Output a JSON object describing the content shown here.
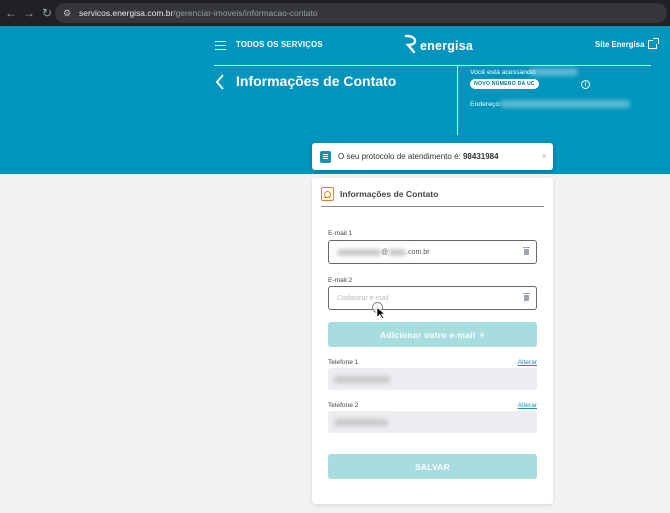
{
  "browser": {
    "url_host": "servicos.energisa.com.br",
    "url_path": "/gerenciar-imoveis/informacao-contato"
  },
  "header": {
    "services_label": "TODOS OS SERVIÇOS",
    "logo_text": "energisa",
    "site_link": "Site Energisa",
    "page_title": "Informações de Contato",
    "accessing_label": "Você está acessando:",
    "uc_badge": "NOVO NÚMERO DA UC",
    "address_label": "Endereço:"
  },
  "toast": {
    "text": "O seu protocolo de atendimento é:",
    "protocol": "98431984",
    "close": "×"
  },
  "card": {
    "title": "Informações de Contato",
    "email1": {
      "label": "E-mail 1",
      "value_suffix": ".com.br",
      "at_symbol": "@"
    },
    "email2": {
      "label": "E-mail 2",
      "placeholder": "Cadastrar e-mail"
    },
    "add_email_button": "Adicionar outro e-mail",
    "add_email_plus": "+",
    "phone1": {
      "label": "Telefone 1",
      "alter": "Alterar"
    },
    "phone2": {
      "label": "Telefone 2",
      "alter": "Alterar"
    },
    "save_button": "SALVAR"
  },
  "colors": {
    "header_bg": "#0095bd",
    "button_disabled": "#a8dde0",
    "link": "#1a8fb1"
  }
}
